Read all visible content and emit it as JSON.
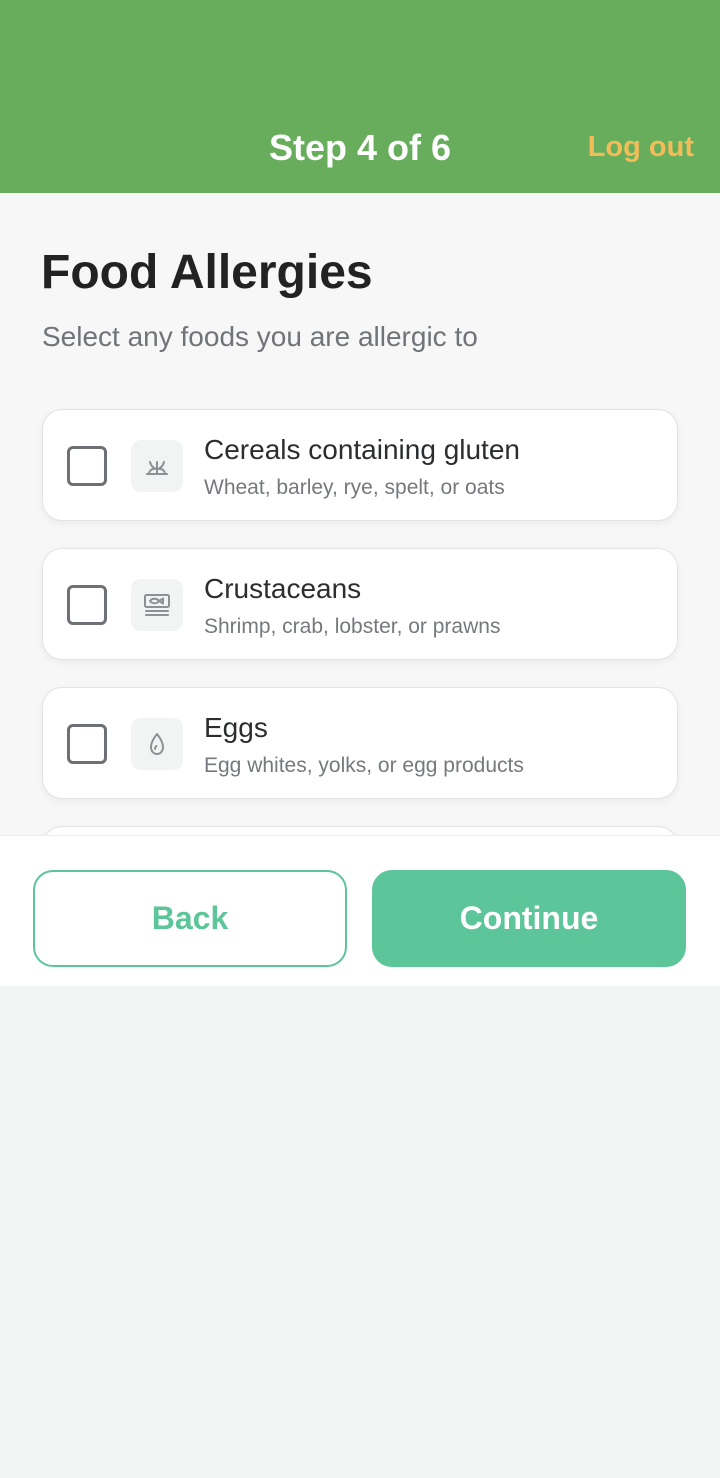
{
  "header": {
    "title": "Step 4 of 6",
    "logout_label": "Log out",
    "background_color": "#68ad5b",
    "logout_color": "#f2bd58"
  },
  "page": {
    "title": "Food Allergies",
    "subtitle": "Select any foods you are allergic to"
  },
  "options": [
    {
      "title": "Cereals containing gluten",
      "description": "Wheat, barley, rye, spelt, or oats",
      "icon": "wheat-icon",
      "checked": false
    },
    {
      "title": "Crustaceans",
      "description": "Shrimp, crab, lobster, or prawns",
      "icon": "fish-icon",
      "checked": false
    },
    {
      "title": "Eggs",
      "description": "Egg whites, yolks, or egg products",
      "icon": "egg-icon",
      "checked": false
    }
  ],
  "footer": {
    "back_label": "Back",
    "continue_label": "Continue",
    "accent_color": "#5cc59a"
  }
}
